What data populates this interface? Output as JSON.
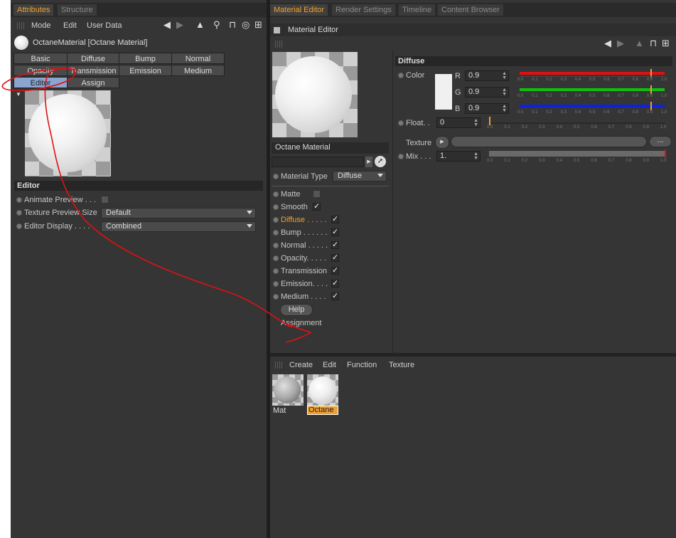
{
  "left_panel": {
    "tabs": [
      "Attributes",
      "Structure"
    ],
    "menu": [
      "Mode",
      "Edit",
      "User Data"
    ],
    "material_title": "OctaneMaterial [Octane Material]",
    "channel_buttons": [
      [
        "Basic",
        "Diffuse",
        "Bump",
        "Normal"
      ],
      [
        "Opacity",
        "Transmission",
        "Emission",
        "Medium"
      ],
      [
        "Editor",
        "Assign"
      ]
    ],
    "selected_button": "Editor",
    "editor_section": {
      "title": "Editor",
      "rows": [
        {
          "label": "Animate Preview . . .",
          "type": "checkbox"
        },
        {
          "label": "Texture Preview Size",
          "value": "Default"
        },
        {
          "label": "Editor Display . . . .",
          "value": "Combined"
        }
      ]
    }
  },
  "right_panel": {
    "tabs": [
      "Material Editor",
      "Render Settings",
      "Timeline",
      "Content Browser"
    ],
    "window_title": "Material Editor",
    "material_name": "Octane Material",
    "material_type_label": "Material Type",
    "material_type_value": "Diffuse",
    "channels": [
      {
        "label": "Matte",
        "checked": false
      },
      {
        "label": "Smooth",
        "checked": true
      },
      {
        "label": "Diffuse . . . . .",
        "checked": true,
        "active": true
      },
      {
        "label": "Bump . . . . . .",
        "checked": true
      },
      {
        "label": "Normal . . . . .",
        "checked": true
      },
      {
        "label": "Opacity. . . . .",
        "checked": true
      },
      {
        "label": "Transmission",
        "checked": true
      },
      {
        "label": "Emission. . . .",
        "checked": true
      },
      {
        "label": "Medium . . . .",
        "checked": true
      }
    ],
    "help_label": "Help",
    "assignment_label": "Assignment",
    "diffuse": {
      "title": "Diffuse",
      "color_label": "Color",
      "rgb": [
        {
          "channel": "R",
          "value": "0.9",
          "color": "#e01010"
        },
        {
          "channel": "G",
          "value": "0.9",
          "color": "#10c010"
        },
        {
          "channel": "B",
          "value": "0.9",
          "color": "#1020e0"
        }
      ],
      "float_label": "Float. .",
      "float_value": "0",
      "texture_label": "Texture",
      "texture_button": "...",
      "mix_label": "Mix . . .",
      "mix_value": "1.",
      "tick_labels": [
        "0.0",
        "0.1",
        "0.2",
        "0.3",
        "0.4",
        "0.5",
        "0.6",
        "0.7",
        "0.8",
        "0.9",
        "1.0"
      ]
    },
    "manager_menu": [
      "Create",
      "Edit",
      "Function",
      "Texture"
    ],
    "materials": [
      {
        "name": "Mat",
        "selected": false
      },
      {
        "name": "Octane",
        "selected": true
      }
    ]
  },
  "colors": {
    "accent": "#f0a030",
    "selected_button": "#8aa6d0",
    "annotation": "#e01010"
  }
}
